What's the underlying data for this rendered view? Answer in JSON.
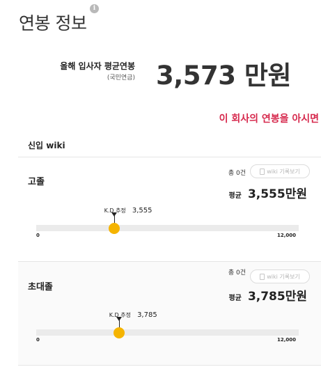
{
  "header": {
    "title": "연봉 정보",
    "info_icon": "info-icon"
  },
  "summary": {
    "label": "올해 입사자 평균연봉",
    "sublabel": "(국민연금)",
    "value": "3,573 만원"
  },
  "cta": "이 회사의 연봉을 아시면",
  "section": {
    "title": "신입 wiki"
  },
  "cards": [
    {
      "education": "고졸",
      "count": "총 0건",
      "wiki_button": "wiki 기록보기",
      "avg_label": "평균",
      "avg_value": "3,555만원",
      "est_label": "K.D 추정",
      "est_value": "3,555",
      "est_fraction": 0.296,
      "axis_min": "0",
      "axis_max": "12,000"
    },
    {
      "education": "초대졸",
      "count": "총 0건",
      "wiki_button": "wiki 기록보기",
      "avg_label": "평균",
      "avg_value": "3,785만원",
      "est_label": "K.D 추정",
      "est_value": "3,785",
      "est_fraction": 0.315,
      "axis_min": "0",
      "axis_max": "12,000"
    }
  ],
  "colors": {
    "accent": "#d6284c",
    "knob": "#f5b400",
    "track": "#ebebeb"
  }
}
